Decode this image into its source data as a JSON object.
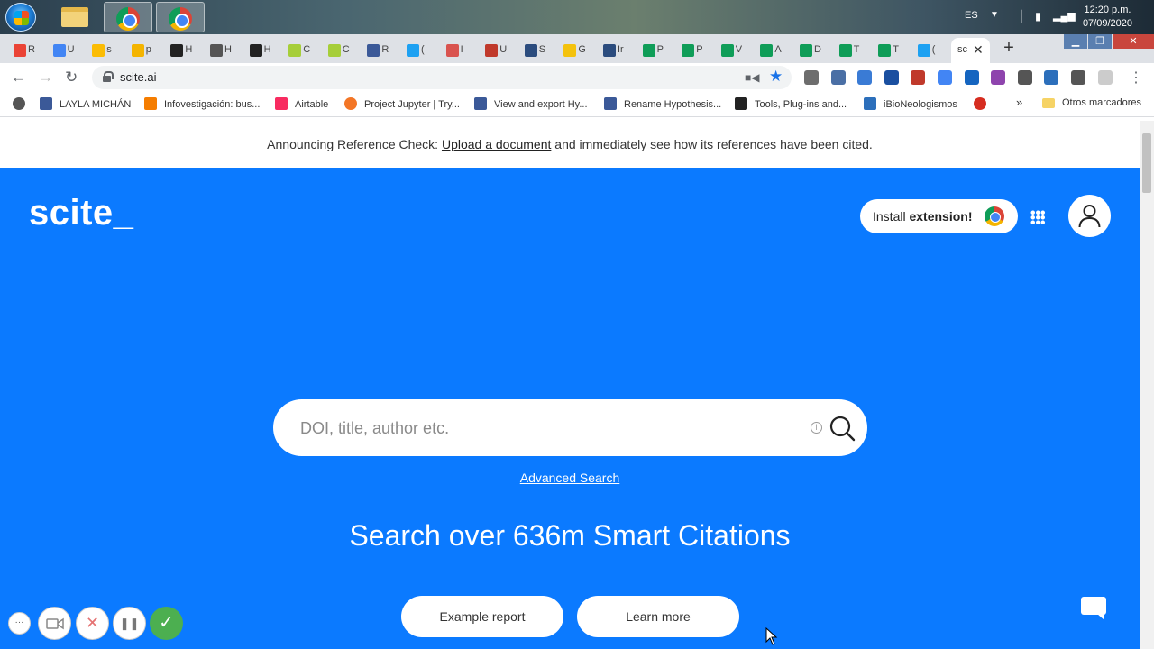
{
  "taskbar": {
    "language": "ES",
    "time": "12:20 p.m.",
    "date": "07/09/2020"
  },
  "browser": {
    "tabs": [
      {
        "label": "R",
        "icon": "gmail-icon",
        "color": "#ea4335"
      },
      {
        "label": "U",
        "icon": "calendar-icon",
        "color": "#4285f4"
      },
      {
        "label": "s",
        "icon": "drive-icon",
        "color": "#fbbc04"
      },
      {
        "label": "p",
        "icon": "slides-icon",
        "color": "#f4b400"
      },
      {
        "label": "H",
        "icon": "hypothesis-icon",
        "color": "#222222"
      },
      {
        "label": "H",
        "icon": "globe-icon",
        "color": "#555555"
      },
      {
        "label": "H",
        "icon": "hypothesis-icon",
        "color": "#222222"
      },
      {
        "label": "C",
        "icon": "orcid-icon",
        "color": "#a6ce39"
      },
      {
        "label": "C",
        "icon": "orcid-icon",
        "color": "#a6ce39"
      },
      {
        "label": "R",
        "icon": "table-icon",
        "color": "#3b5998"
      },
      {
        "label": "(",
        "icon": "twitter-icon",
        "color": "#1da1f2"
      },
      {
        "label": "I",
        "icon": "palette-icon",
        "color": "#d9534f"
      },
      {
        "label": "U",
        "icon": "library-icon",
        "color": "#c0392b"
      },
      {
        "label": "S",
        "icon": "p-icon",
        "color": "#2b4c7e"
      },
      {
        "label": "G",
        "icon": "bulb-icon",
        "color": "#f4c20d"
      },
      {
        "label": "Ir",
        "icon": "p-icon",
        "color": "#2b4c7e"
      },
      {
        "label": "P",
        "icon": "classroom-icon",
        "color": "#0f9d58"
      },
      {
        "label": "P",
        "icon": "classroom-icon",
        "color": "#0f9d58"
      },
      {
        "label": "V",
        "icon": "classroom-icon",
        "color": "#0f9d58"
      },
      {
        "label": "A",
        "icon": "classroom-icon",
        "color": "#0f9d58"
      },
      {
        "label": "D",
        "icon": "classroom-icon",
        "color": "#0f9d58"
      },
      {
        "label": "T",
        "icon": "classroom-icon",
        "color": "#0f9d58"
      },
      {
        "label": "T",
        "icon": "classroom-icon",
        "color": "#0f9d58"
      },
      {
        "label": "(",
        "icon": "twitter-icon",
        "color": "#1da1f2"
      }
    ],
    "active_tab": {
      "label": "sc",
      "close": "✕"
    },
    "new_tab": "+",
    "url": "scite.ai",
    "extensions": [
      "#6d6d6d",
      "#4a6fa5",
      "#3a7bd5",
      "#1a4fa0",
      "#c0392b",
      "#4285f4",
      "#1565c0",
      "#8e44ad",
      "#555555",
      "#2c6fbb",
      "#555555",
      "#cccccc"
    ],
    "bookmarks": [
      {
        "label": "",
        "color": "#555555",
        "icon": "globe-icon"
      },
      {
        "label": "LAYLA MICHÁN",
        "color": "#3b5998",
        "icon": "table-icon"
      },
      {
        "label": "Infovestigación: bus...",
        "color": "#f57d00",
        "icon": "blogger-icon"
      },
      {
        "label": "Airtable",
        "color": "#f82b60",
        "icon": "airtable-icon"
      },
      {
        "label": "Project Jupyter | Try...",
        "color": "#f37626",
        "icon": "jupyter-icon"
      },
      {
        "label": "View and export Hy...",
        "color": "#3b5998",
        "icon": "table-icon"
      },
      {
        "label": "Rename Hypothesis...",
        "color": "#3b5998",
        "icon": "table-icon"
      },
      {
        "label": "Tools, Plug-ins and...",
        "color": "#222222",
        "icon": "hypothesis-icon"
      },
      {
        "label": "iBioNeologismos",
        "color": "#2c6fbb",
        "icon": "new-icon"
      },
      {
        "label": "",
        "color": "#d62d20",
        "icon": "colorwheel-icon"
      }
    ],
    "more": "»",
    "other_bookmarks": "Otros marcadores"
  },
  "page": {
    "announce_prefix": "Announcing Reference Check: ",
    "announce_link": "Upload a document",
    "announce_suffix": " and immediately see how its references have been cited.",
    "logo": "scite_",
    "install_prefix": "Install ",
    "install_bold": "extension!",
    "search_placeholder": "DOI, title, author etc.",
    "info_glyph": "i",
    "advanced_search": "Advanced Search",
    "headline": "Search over 636m Smart Citations",
    "example_report": "Example report",
    "learn_more": "Learn more",
    "brand_color": "#0b7aff"
  },
  "recorder": {
    "more": "···",
    "cancel": "✕",
    "pause": "❚❚",
    "done": "✓"
  }
}
